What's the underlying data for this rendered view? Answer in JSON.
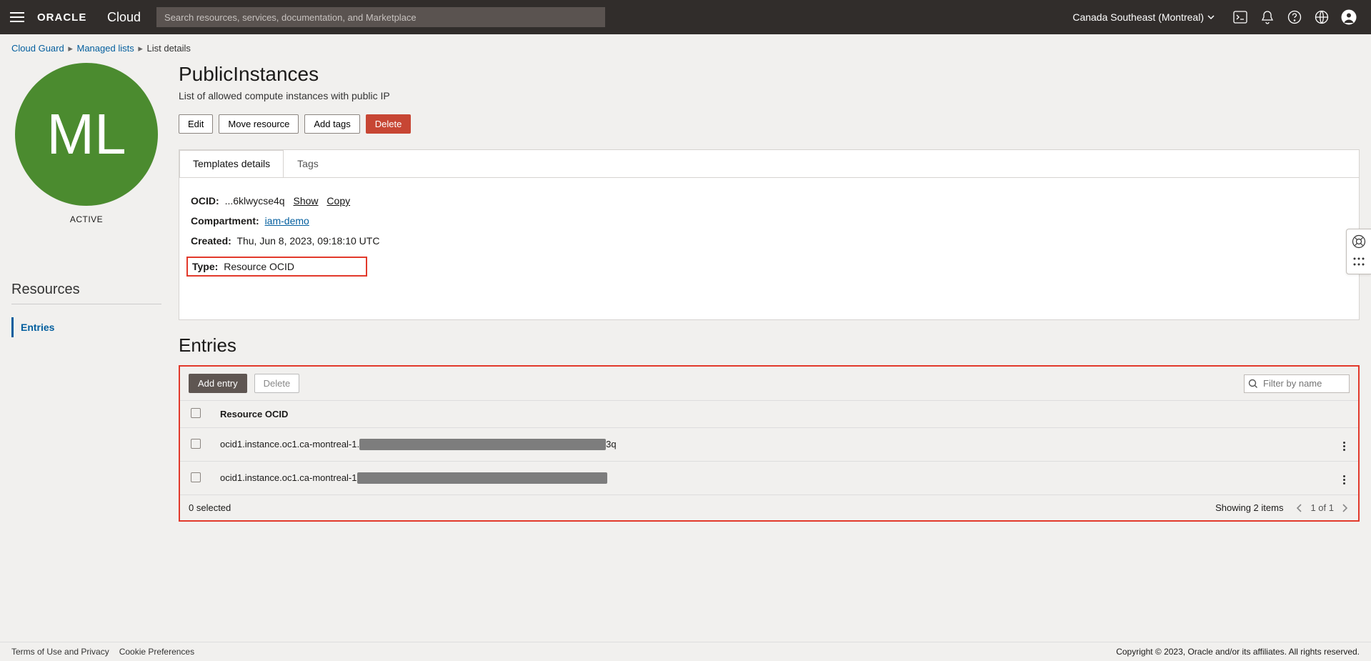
{
  "topbar": {
    "logo_text": "Cloud",
    "search_placeholder": "Search resources, services, documentation, and Marketplace",
    "region": "Canada Southeast (Montreal)"
  },
  "breadcrumb": {
    "items": [
      "Cloud Guard",
      "Managed lists",
      "List details"
    ]
  },
  "resource": {
    "icon_letters": "ML",
    "status": "ACTIVE",
    "title": "PublicInstances",
    "description": "List of allowed compute instances with public IP"
  },
  "actions": {
    "edit": "Edit",
    "move": "Move resource",
    "add_tags": "Add tags",
    "delete": "Delete"
  },
  "tabs": {
    "templates": "Templates details",
    "tags": "Tags"
  },
  "details": {
    "ocid_label": "OCID:",
    "ocid_value": "...6klwycse4q",
    "show": "Show",
    "copy": "Copy",
    "compartment_label": "Compartment:",
    "compartment_value": "iam-demo",
    "created_label": "Created:",
    "created_value": "Thu, Jun 8, 2023, 09:18:10 UTC",
    "type_label": "Type:",
    "type_value": "Resource OCID"
  },
  "sidebar_nav": {
    "heading": "Resources",
    "entries": "Entries"
  },
  "entries": {
    "heading": "Entries",
    "add_entry": "Add entry",
    "delete": "Delete",
    "filter_placeholder": "Filter by name",
    "col_header": "Resource OCID",
    "row1_prefix": "ocid1.instance.oc1.ca-montreal-1.",
    "row1_suffix": "3q",
    "row2_prefix": "ocid1.instance.oc1.ca-montreal-1",
    "selected_text": "0 selected",
    "showing_text": "Showing 2 items",
    "page_text": "1 of 1"
  },
  "footer": {
    "terms": "Terms of Use and Privacy",
    "cookies": "Cookie Preferences",
    "copyright": "Copyright © 2023, Oracle and/or its affiliates. All rights reserved."
  }
}
